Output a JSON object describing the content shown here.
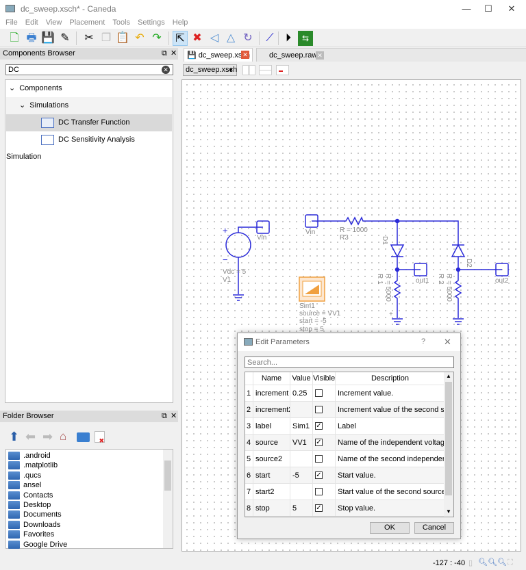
{
  "window": {
    "title": "dc_sweep.xsch* - Caneda",
    "minimize": "—",
    "maximize": "☐",
    "close": "✕"
  },
  "menu": [
    "File",
    "Edit",
    "View",
    "Placement",
    "Tools",
    "Settings",
    "Help"
  ],
  "toolbar": [
    "new-file",
    "print",
    "save",
    "save-as",
    "cut",
    "copy",
    "paste",
    "undo",
    "redo",
    "select",
    "delete",
    "mirror-x",
    "mirror-y",
    "rotate",
    "wire",
    "simulate",
    "open-results"
  ],
  "components_browser": {
    "title": "Components Browser",
    "search_value": "DC",
    "tree": {
      "root": "Components",
      "group": "Simulations",
      "items": [
        "DC Transfer Function",
        "DC Sensitivity Analysis Simulation"
      ],
      "selected": 0
    }
  },
  "folder_browser": {
    "title": "Folder Browser",
    "toolbar": [
      "up-arrow",
      "back-arrow",
      "forward-arrow",
      "home",
      "new-folder",
      "delete"
    ],
    "items": [
      ".android",
      ".matplotlib",
      ".qucs",
      "ansel",
      "Contacts",
      "Desktop",
      "Documents",
      "Downloads",
      "Favorites",
      "Google Drive"
    ]
  },
  "tabs": [
    {
      "label": "dc_sweep.xsch",
      "active": true
    },
    {
      "label": "dc_sweep.raw",
      "active": false
    }
  ],
  "view_selector": "dc_sweep.xsch",
  "schematic": {
    "v1": {
      "value": "Vdc = 5",
      "label": "V1",
      "port": "Vin",
      "plus": "+",
      "minus": "−"
    },
    "vin_port": "Vin",
    "r3": {
      "value": "R = 1000",
      "label": "R3"
    },
    "d1": "D1",
    "d2": "D2",
    "r1": {
      "value": "R = 5000",
      "label": "R 1"
    },
    "r2": {
      "value": "R = 5000",
      "label": "R 2"
    },
    "out1": "out1",
    "out2": "out2",
    "plus": "+",
    "sim1": {
      "label": "Sim1",
      "source": "source = VV1",
      "start": "start = -5",
      "stop": "stop = 5"
    }
  },
  "status": {
    "coords": "-127 : -40"
  },
  "dialog": {
    "title": "Edit Parameters",
    "help": "?",
    "close": "✕",
    "search_placeholder": "Search...",
    "columns": [
      "Name",
      "Value",
      "Visible",
      "Description"
    ],
    "rows": [
      {
        "n": "1",
        "name": "increment",
        "value": "0.25",
        "visible": false,
        "desc": "Increment value."
      },
      {
        "n": "2",
        "name": "increment2",
        "value": "",
        "visible": false,
        "desc": "Increment value of the second sou..."
      },
      {
        "n": "3",
        "name": "label",
        "value": "Sim1",
        "visible": true,
        "desc": "Label"
      },
      {
        "n": "4",
        "name": "source",
        "value": "VV1",
        "visible": true,
        "desc": "Name of the independent voltage ..."
      },
      {
        "n": "5",
        "name": "source2",
        "value": "",
        "visible": false,
        "desc": "Name of the second independent ..."
      },
      {
        "n": "6",
        "name": "start",
        "value": "-5",
        "visible": true,
        "desc": "Start value."
      },
      {
        "n": "7",
        "name": "start2",
        "value": "",
        "visible": false,
        "desc": "Start value of the second source."
      },
      {
        "n": "8",
        "name": "stop",
        "value": "5",
        "visible": true,
        "desc": "Stop value."
      }
    ],
    "ok": "OK",
    "cancel": "Cancel"
  },
  "colors": {
    "wire": "#2a2ad8",
    "sim": "#f0a040",
    "tab_close": "#e05a3a"
  }
}
